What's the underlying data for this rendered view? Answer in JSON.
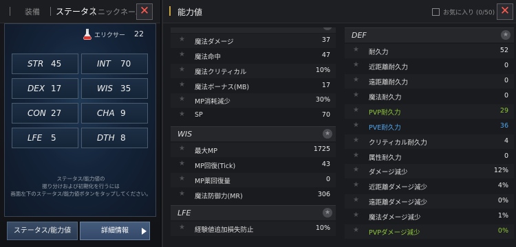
{
  "left": {
    "tabs": [
      "装備",
      "ステータス",
      "ニックネーム"
    ],
    "elixir": {
      "label": "エリクサー",
      "value": "22"
    },
    "stats": [
      {
        "name": "STR",
        "value": "45"
      },
      {
        "name": "INT",
        "value": "70"
      },
      {
        "name": "DEX",
        "value": "17"
      },
      {
        "name": "WIS",
        "value": "35"
      },
      {
        "name": "CON",
        "value": "27"
      },
      {
        "name": "CHA",
        "value": "9"
      },
      {
        "name": "LFE",
        "value": "5"
      },
      {
        "name": "DTH",
        "value": "8"
      }
    ],
    "note_lines": [
      "ステータス/能力値の",
      "振り分けおよび初期化を行うには",
      "画面左下のステータス/能力値ボタンをタップしてください。"
    ],
    "buttons": {
      "status": "ステータス/能力値",
      "detail": "詳細情報"
    },
    "close": "✕"
  },
  "right": {
    "title": "能力値",
    "favorite": {
      "label": "お気に入り (0/50)"
    },
    "close": "✕",
    "left_rows": [
      {
        "label": "魔法ダメージ",
        "value": "37"
      },
      {
        "label": "魔法命中",
        "value": "47"
      },
      {
        "label": "魔法クリティカル",
        "value": "10%"
      },
      {
        "label": "魔法ボーナス(MB)",
        "value": "17"
      },
      {
        "label": "MP消耗減少",
        "value": "30%"
      },
      {
        "label": "SP",
        "value": "70"
      }
    ],
    "wis": {
      "title": "WIS",
      "rows": [
        {
          "label": "最大MP",
          "value": "1725"
        },
        {
          "label": "MP回復(Tick)",
          "value": "43"
        },
        {
          "label": "MP薬回復量",
          "value": "0"
        },
        {
          "label": "魔法防御力(MR)",
          "value": "306"
        }
      ]
    },
    "lfe": {
      "title": "LFE",
      "rows": [
        {
          "label": "経験値追加損失防止",
          "value": "10%"
        }
      ]
    },
    "def": {
      "title": "DEF",
      "rows": [
        {
          "label": "耐久力",
          "value": "52"
        },
        {
          "label": "近距離耐久力",
          "value": "0"
        },
        {
          "label": "遠距離耐久力",
          "value": "0"
        },
        {
          "label": "魔法耐久力",
          "value": "0"
        },
        {
          "label": "PVP耐久力",
          "value": "29",
          "color": "green"
        },
        {
          "label": "PVE耐久力",
          "value": "36",
          "color": "blue"
        },
        {
          "label": "クリティカル耐久力",
          "value": "4"
        },
        {
          "label": "属性耐久力",
          "value": "0"
        },
        {
          "label": "ダメージ減少",
          "value": "12%"
        },
        {
          "label": "近距離ダメージ減少",
          "value": "4%"
        },
        {
          "label": "遠距離ダメージ減少",
          "value": "0%"
        },
        {
          "label": "魔法ダメージ減少",
          "value": "1%"
        },
        {
          "label": "PVPダメージ減少",
          "value": "0%",
          "color": "green"
        }
      ]
    }
  },
  "colors": {
    "accent": "#c9a441",
    "green": "#8ec639",
    "blue": "#4fa3e8",
    "close_x": "#ff5a4e"
  }
}
